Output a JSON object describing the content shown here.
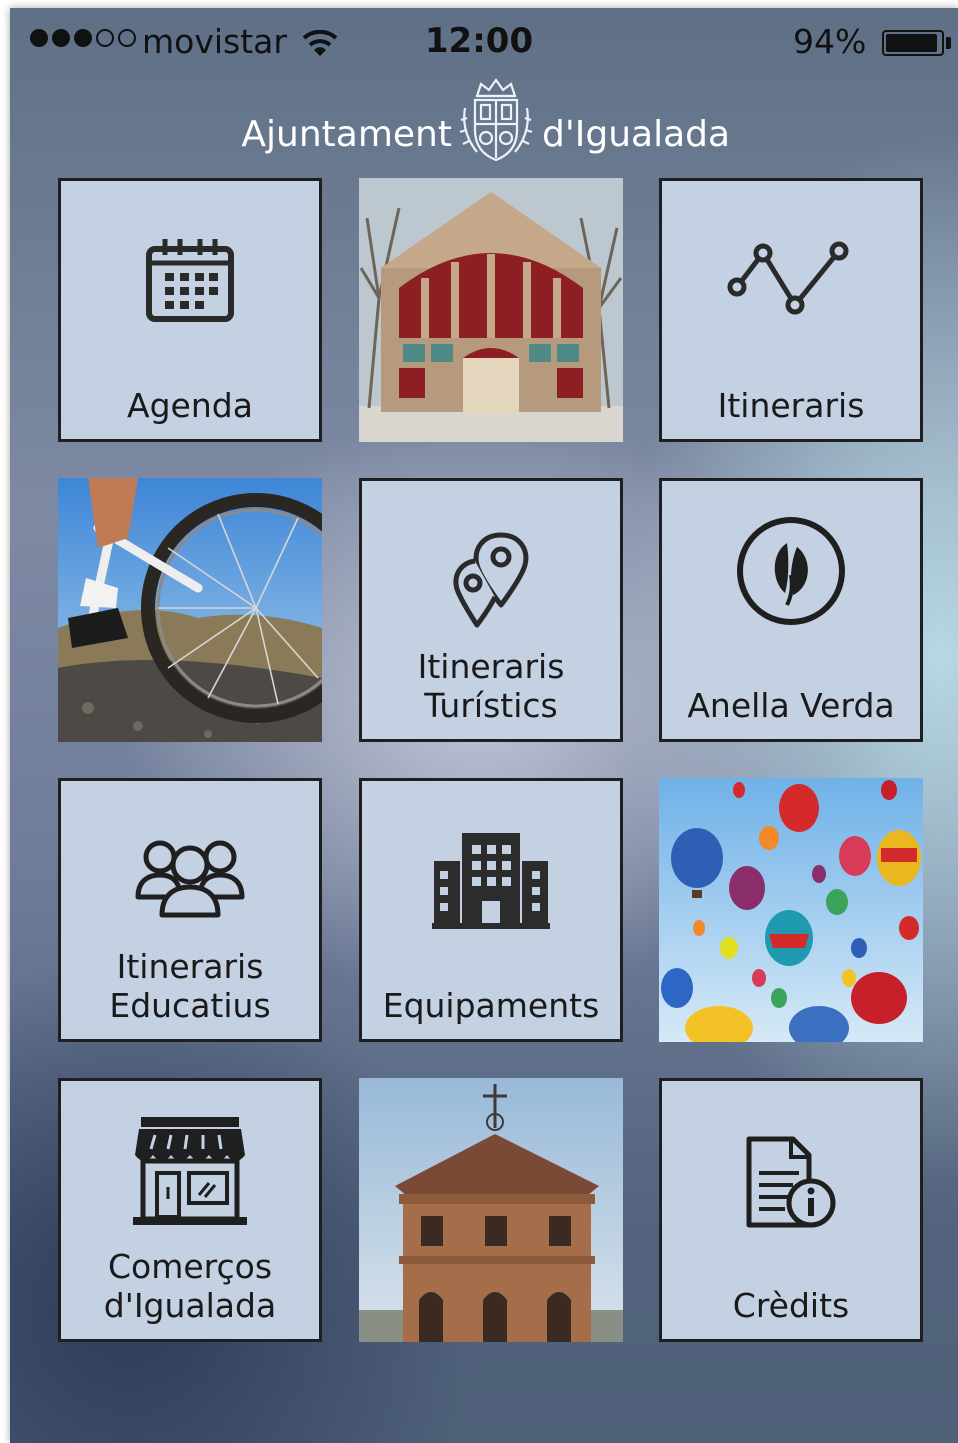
{
  "status_bar": {
    "carrier": "movistar",
    "time": "12:00",
    "battery": "94%",
    "signal_dots_filled": 3,
    "signal_dots_total": 5,
    "battery_level": 0.94
  },
  "header": {
    "logo_left": "Ajuntament",
    "logo_right": "d'Igualada",
    "crest_icon": "coat-of-arms-icon"
  },
  "tiles": [
    {
      "label": "Agenda",
      "icon": "calendar-icon"
    },
    {
      "label": "",
      "image": "building-facade-photo"
    },
    {
      "label": "Itineraris",
      "icon": "route-line-icon"
    },
    {
      "label": "",
      "image": "bicycle-wheel-photo"
    },
    {
      "label_line1": "Itineraris",
      "label_line2": "Turístics",
      "icon": "map-pins-icon"
    },
    {
      "label": "Anella Verda",
      "icon": "leaf-circle-icon"
    },
    {
      "label_line1": "Itineraris",
      "label_line2": "Educatius",
      "icon": "group-people-icon"
    },
    {
      "label": "Equipaments",
      "icon": "building-icon"
    },
    {
      "label": "",
      "image": "hot-air-balloons-photo"
    },
    {
      "label_line1": "Comerços",
      "label_line2": "d'Igualada",
      "icon": "shop-icon"
    },
    {
      "label": "",
      "image": "bell-tower-photo"
    },
    {
      "label": "Crèdits",
      "icon": "document-info-icon"
    }
  ],
  "colors": {
    "tile_bg": "#c3d1e3",
    "tile_border": "#1f1f1f",
    "icon": "#2a2a2a"
  }
}
